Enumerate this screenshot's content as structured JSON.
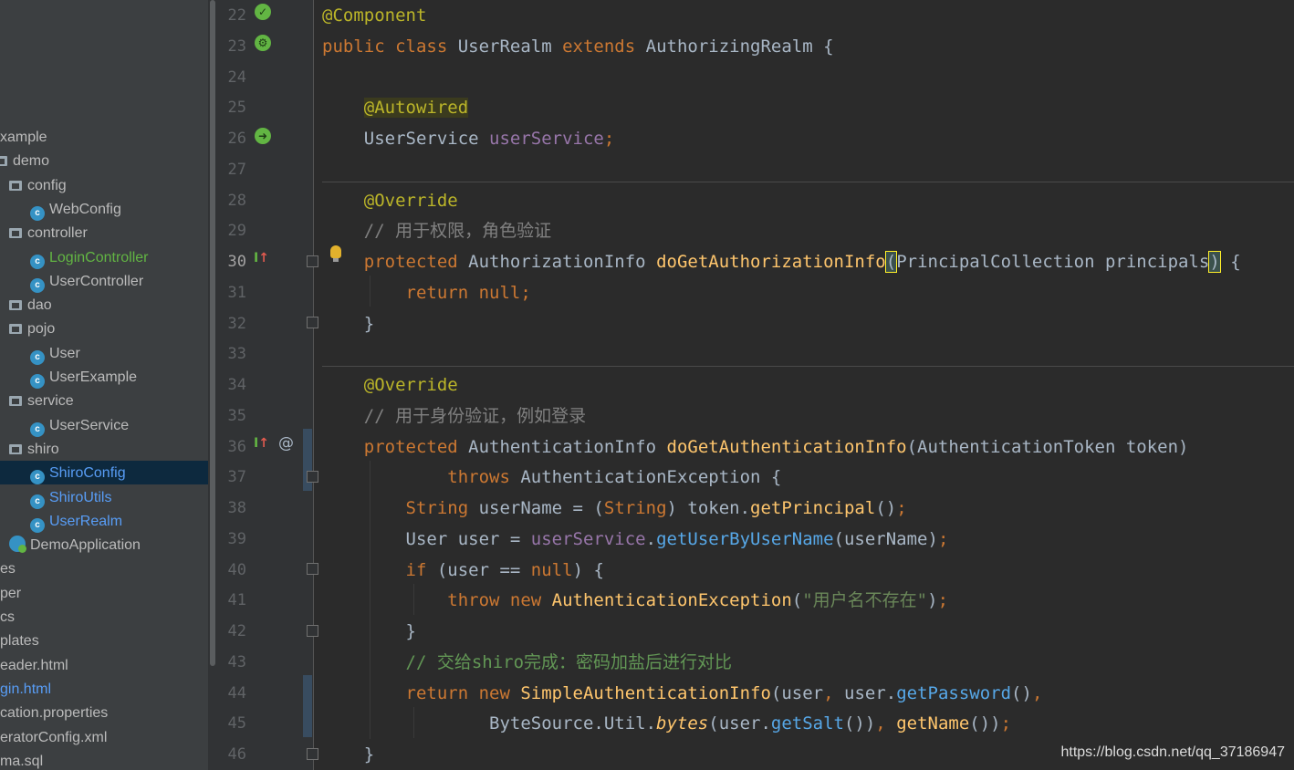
{
  "project_tree": [
    {
      "label": "xample",
      "kind": "package",
      "depth": 0
    },
    {
      "label": "demo",
      "kind": "package",
      "depth": 0
    },
    {
      "label": "config",
      "kind": "folder",
      "depth": 1
    },
    {
      "label": "WebConfig",
      "kind": "class",
      "depth": 2
    },
    {
      "label": "controller",
      "kind": "folder",
      "depth": 1
    },
    {
      "label": "LoginController",
      "kind": "class",
      "depth": 2,
      "color": "#62b543"
    },
    {
      "label": "UserController",
      "kind": "class",
      "depth": 2
    },
    {
      "label": "dao",
      "kind": "folder",
      "depth": 1
    },
    {
      "label": "pojo",
      "kind": "folder",
      "depth": 1
    },
    {
      "label": "User",
      "kind": "class",
      "depth": 2
    },
    {
      "label": "UserExample",
      "kind": "class",
      "depth": 2
    },
    {
      "label": "service",
      "kind": "folder",
      "depth": 1
    },
    {
      "label": "UserService",
      "kind": "class",
      "depth": 2
    },
    {
      "label": "shiro",
      "kind": "folder",
      "depth": 1
    },
    {
      "label": "ShiroConfig",
      "kind": "class",
      "depth": 2,
      "color": "#589df6",
      "selected": true
    },
    {
      "label": "ShiroUtils",
      "kind": "class",
      "depth": 2,
      "color": "#589df6"
    },
    {
      "label": "UserRealm",
      "kind": "class",
      "depth": 2,
      "color": "#589df6"
    },
    {
      "label": "DemoApplication",
      "kind": "app",
      "depth": 1
    },
    {
      "label": "es",
      "kind": "text",
      "depth": 0
    },
    {
      "label": "per",
      "kind": "text",
      "depth": 0
    },
    {
      "label": "cs",
      "kind": "text",
      "depth": 0
    },
    {
      "label": "plates",
      "kind": "text",
      "depth": 0
    },
    {
      "label": "eader.html",
      "kind": "text",
      "depth": 0
    },
    {
      "label": "gin.html",
      "kind": "text",
      "depth": 0,
      "color": "#589df6"
    },
    {
      "label": "cation.properties",
      "kind": "text",
      "depth": 0
    },
    {
      "label": "eratorConfig.xml",
      "kind": "text",
      "depth": 0
    },
    {
      "label": "ma.sql",
      "kind": "text",
      "depth": 0
    }
  ],
  "editor": {
    "line_numbers": [
      "22",
      "23",
      "24",
      "25",
      "26",
      "27",
      "28",
      "29",
      "30",
      "31",
      "32",
      "33",
      "34",
      "35",
      "36",
      "37",
      "38",
      "39",
      "40",
      "41",
      "42",
      "43",
      "44",
      "45",
      "46"
    ],
    "current_line": "30",
    "lines": [
      [
        [
          "ann",
          "@Component"
        ]
      ],
      [
        [
          "kw",
          "public class "
        ],
        [
          "",
          "UserRealm "
        ],
        [
          "kw",
          "extends "
        ],
        [
          "",
          "AuthorizingRealm {"
        ]
      ],
      [],
      [
        [
          "",
          "    "
        ],
        [
          "ann-hl",
          "@Autowired"
        ]
      ],
      [
        [
          "",
          "    UserService "
        ],
        [
          "fld",
          "userService"
        ],
        [
          "kw",
          ";"
        ]
      ],
      [],
      [
        [
          "",
          "    "
        ],
        [
          "ann",
          "@Override"
        ]
      ],
      [
        [
          "",
          "    "
        ],
        [
          "cm",
          "// 用于权限，角色验证"
        ]
      ],
      [
        [
          "",
          "    "
        ],
        [
          "kw",
          "protected "
        ],
        [
          "",
          "AuthorizationInfo "
        ],
        [
          "fn",
          "doGetAuthorizationInfo"
        ],
        [
          "caret-hl",
          "("
        ],
        [
          "",
          "PrincipalCollection principals"
        ],
        [
          "caret-hl",
          ")"
        ],
        [
          "",
          " {"
        ]
      ],
      [
        [
          "",
          "        "
        ],
        [
          "kw",
          "return null;"
        ]
      ],
      [
        [
          "",
          "    }"
        ]
      ],
      [],
      [
        [
          "",
          "    "
        ],
        [
          "ann",
          "@Override"
        ]
      ],
      [
        [
          "",
          "    "
        ],
        [
          "cm",
          "// 用于身份验证，例如登录"
        ]
      ],
      [
        [
          "",
          "    "
        ],
        [
          "kw",
          "protected "
        ],
        [
          "",
          "AuthenticationInfo "
        ],
        [
          "fn",
          "doGetAuthenticationInfo"
        ],
        [
          "",
          "(AuthenticationToken token)"
        ]
      ],
      [
        [
          "",
          "            "
        ],
        [
          "kw",
          "throws "
        ],
        [
          "",
          "AuthenticationException {"
        ]
      ],
      [
        [
          "",
          "        "
        ],
        [
          "kw",
          "String "
        ],
        [
          "",
          "userName = ("
        ],
        [
          "kw",
          "String"
        ],
        [
          "",
          ") token."
        ],
        [
          "fn",
          "getPrincipal"
        ],
        [
          "",
          "()"
        ],
        [
          "kw",
          ";"
        ]
      ],
      [
        [
          "",
          "        User user = "
        ],
        [
          "fld",
          "userService"
        ],
        [
          "",
          "."
        ],
        [
          "mcall",
          "getUserByUserName"
        ],
        [
          "",
          "(userName)"
        ],
        [
          "kw",
          ";"
        ]
      ],
      [
        [
          "",
          "        "
        ],
        [
          "kw",
          "if "
        ],
        [
          "",
          "(user == "
        ],
        [
          "kw",
          "null"
        ],
        [
          "",
          ") {"
        ]
      ],
      [
        [
          "",
          "            "
        ],
        [
          "kw",
          "throw new "
        ],
        [
          "fn",
          "AuthenticationException"
        ],
        [
          "",
          "("
        ],
        [
          "str",
          "\"用户名不存在\""
        ],
        [
          "",
          ")"
        ],
        [
          "kw",
          ";"
        ]
      ],
      [
        [
          "",
          "        }"
        ]
      ],
      [
        [
          "",
          "        "
        ],
        [
          "cm-green",
          "// 交给shiro完成：密码加盐后进行对比"
        ]
      ],
      [
        [
          "",
          "        "
        ],
        [
          "kw",
          "return new "
        ],
        [
          "fn",
          "SimpleAuthenticationInfo"
        ],
        [
          "",
          "(user"
        ],
        [
          "kw",
          ", "
        ],
        [
          "",
          "user."
        ],
        [
          "mcall",
          "getPassword"
        ],
        [
          "",
          "()"
        ],
        [
          "kw",
          ","
        ]
      ],
      [
        [
          "",
          "                ByteSource.Util."
        ],
        [
          "stat",
          "bytes"
        ],
        [
          "",
          "(user."
        ],
        [
          "mcall",
          "getSalt"
        ],
        [
          "",
          "())"
        ],
        [
          "kw",
          ", "
        ],
        [
          "fn",
          "getName"
        ],
        [
          "",
          "())"
        ],
        [
          "kw",
          ";"
        ]
      ],
      [
        [
          "",
          "    }"
        ]
      ]
    ]
  },
  "watermark": "https://blog.csdn.net/qq_37186947"
}
